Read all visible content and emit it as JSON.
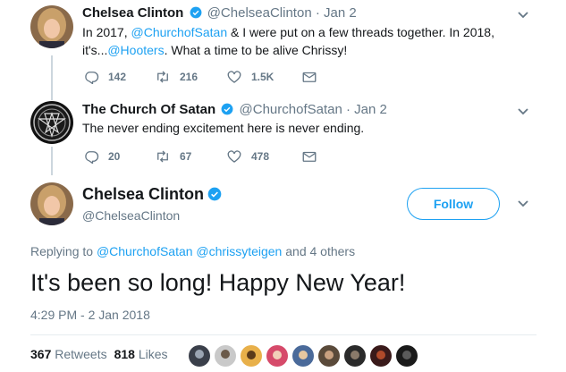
{
  "tweets": [
    {
      "name": "Chelsea Clinton",
      "handle": "@ChelseaClinton",
      "dot": "·",
      "date": "Jan 2",
      "text_parts": {
        "p1": "In 2017, ",
        "m1": "@ChurchofSatan",
        "p2": " & I were put on a few threads together. In 2018,",
        "p3": "it's...",
        "m2": "@Hooters",
        "p4": ". What a time to be alive Chrissy!"
      },
      "replies": "142",
      "retweets": "216",
      "likes": "1.5K"
    },
    {
      "name": "The Church Of Satan",
      "handle": "@ChurchofSatan",
      "dot": "·",
      "date": "Jan 2",
      "text": "The never ending excitement here is never ending.",
      "replies": "20",
      "retweets": "67",
      "likes": "478"
    }
  ],
  "main_tweet": {
    "name": "Chelsea Clinton",
    "handle": "@ChelseaClinton",
    "follow_label": "Follow",
    "replying_prefix": "Replying to ",
    "replying_mentions": "@ChurchofSatan @chrissyteigen",
    "replying_suffix": " and 4 others",
    "text": "It's been so long! Happy New Year!",
    "timestamp": "4:29 PM - 2 Jan 2018",
    "retweets_count": "367",
    "retweets_label": "Retweets",
    "likes_count": "818",
    "likes_label": "Likes"
  },
  "icons": {
    "verified": "verified-badge-icon",
    "caret": "chevron-down-icon",
    "reply": "reply-icon",
    "retweet": "retweet-icon",
    "like": "heart-icon",
    "dm": "envelope-icon"
  },
  "colors": {
    "accent": "#1da1f2",
    "secondary_text": "#657786",
    "thread_line": "#ccd6dd"
  }
}
